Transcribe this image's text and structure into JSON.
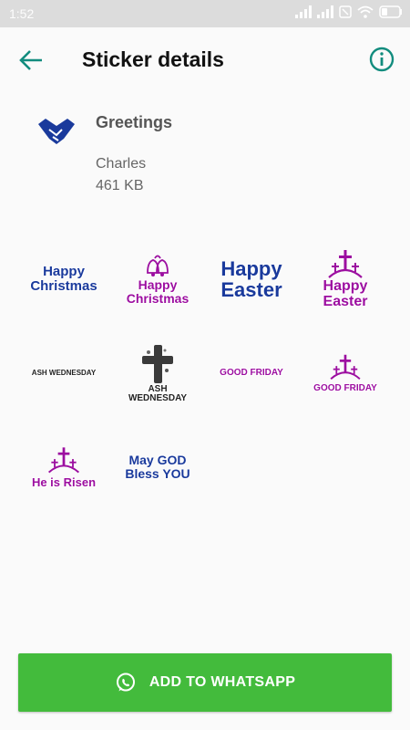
{
  "status_bar": {
    "time": "1:52"
  },
  "app_bar": {
    "title": "Sticker details"
  },
  "pack": {
    "name": "Greetings",
    "author": "Charles",
    "size": "461 KB"
  },
  "stickers": [
    {
      "line1": "Happy",
      "line2": "Christmas"
    },
    {
      "line1": "Happy",
      "line2": "Christmas"
    },
    {
      "line1": "Happy",
      "line2": "Easter"
    },
    {
      "line1": "Happy",
      "line2": "Easter"
    },
    {
      "line1": "ASH WEDNESDAY"
    },
    {
      "line1": "ASH",
      "line2": "WEDNESDAY"
    },
    {
      "line1": "GOOD FRIDAY"
    },
    {
      "line1": "GOOD FRIDAY"
    },
    {
      "line1": "He is Risen"
    },
    {
      "line1": "May GOD",
      "line2": "Bless YOU"
    }
  ],
  "action": {
    "label": "ADD TO WHATSAPP"
  },
  "colors": {
    "accent": "#128c7e",
    "button": "#43bb3c",
    "sticker_blue": "#1a3a9c",
    "sticker_purple": "#9c0ea0"
  }
}
